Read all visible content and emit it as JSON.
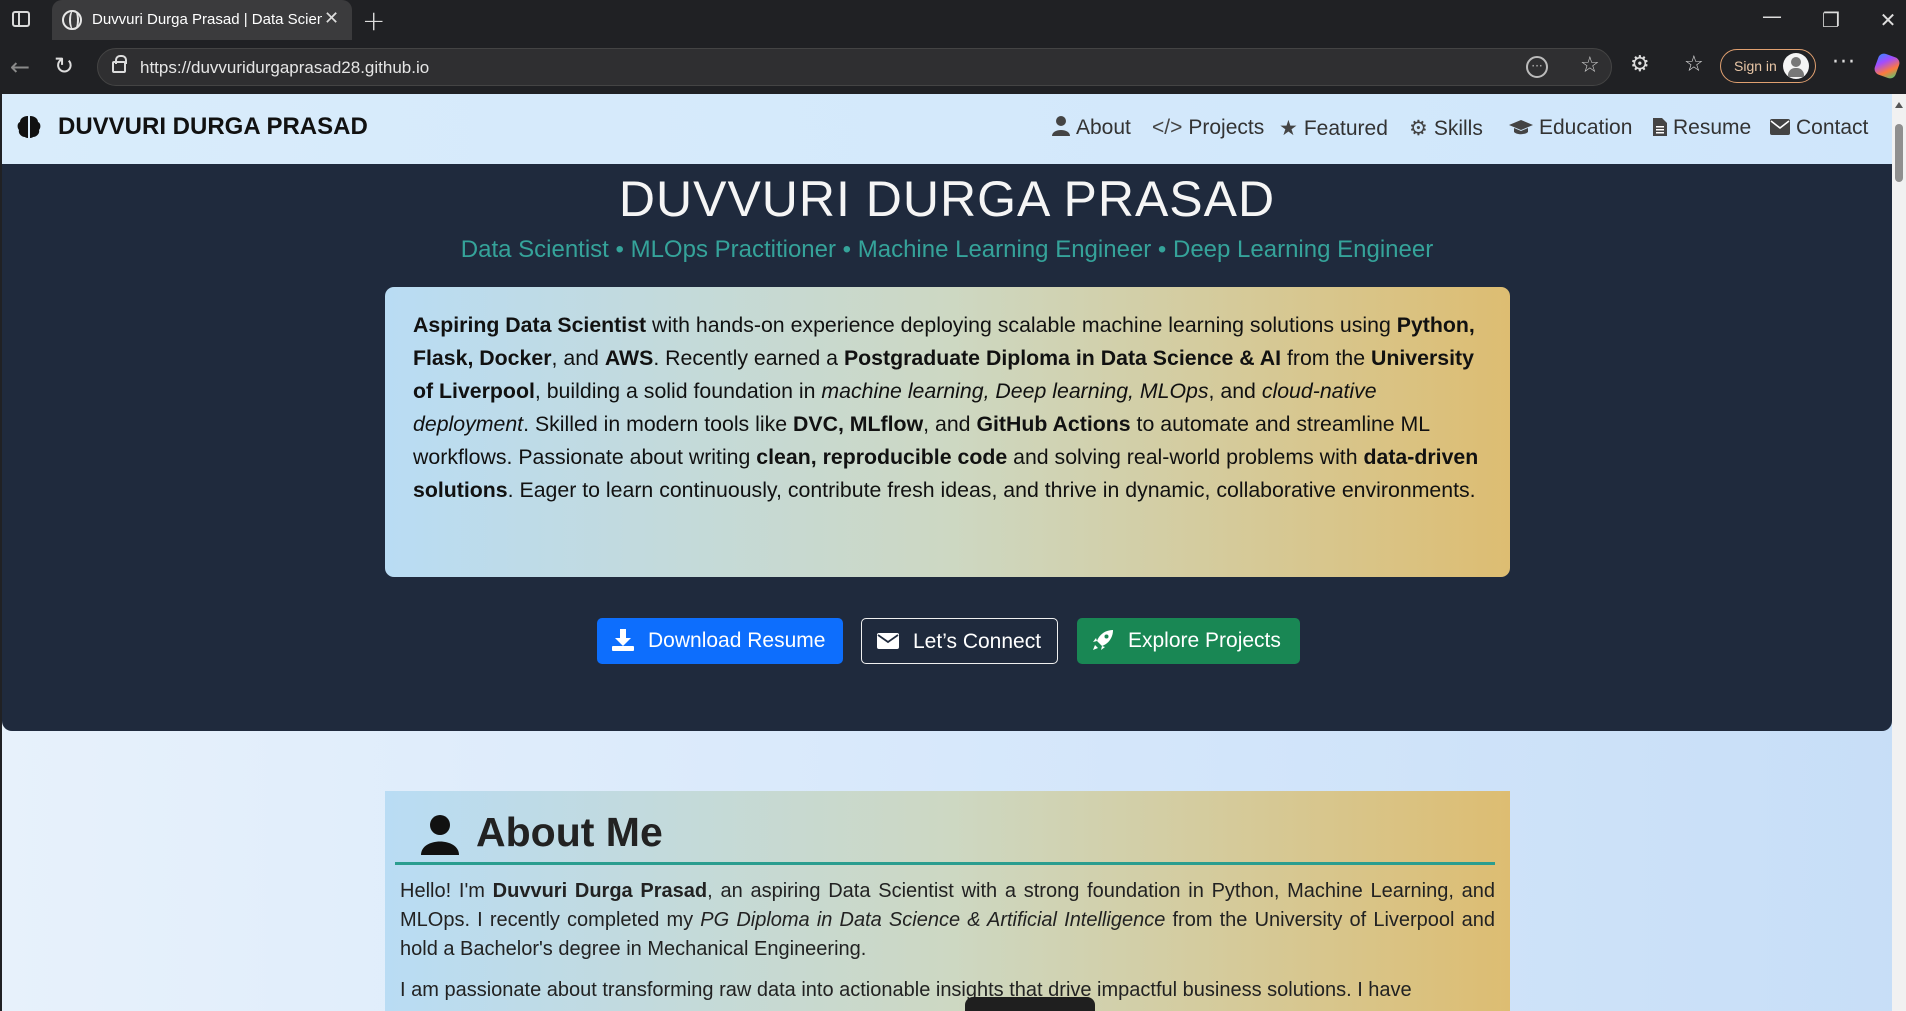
{
  "browser": {
    "tab_title": "Duvvuri Durga Prasad | Data Scientist",
    "url": "https://duvvuridurgaprasad28.github.io",
    "signin_label": "Sign in"
  },
  "navbar": {
    "brand": "DUVVURI DURGA PRASAD",
    "items": [
      {
        "label": "About",
        "icon": "user-icon"
      },
      {
        "label": "Projects",
        "icon": "code-icon"
      },
      {
        "label": "Featured",
        "icon": "star-icon"
      },
      {
        "label": "Skills",
        "icon": "gears-icon"
      },
      {
        "label": "Education",
        "icon": "graduation-cap-icon"
      },
      {
        "label": "Resume",
        "icon": "file-icon"
      },
      {
        "label": "Contact",
        "icon": "envelope-icon"
      }
    ]
  },
  "hero": {
    "name": "DUVVURI DURGA PRASAD",
    "subtitle": "Data Scientist • MLOps Practitioner • Machine Learning Engineer • Deep Learning Engineer",
    "summary": {
      "s1": "Aspiring Data Scientist",
      "s2": " with hands-on experience deploying scalable machine learning solutions using ",
      "s3": "Python, Flask, Docker",
      "s4": ", and ",
      "s5": "AWS",
      "s6": ". Recently earned a ",
      "s7": "Postgraduate Diploma in Data Science & AI",
      "s8": " from the ",
      "s9": "University of Liverpool",
      "s10": ", building a solid foundation in ",
      "s11": "machine learning, Deep learning, MLOps",
      "s12": ", and ",
      "s13": "cloud-native deployment",
      "s14": ". Skilled in modern tools like ",
      "s15": "DVC, MLflow",
      "s16": ", and ",
      "s17": "GitHub Actions",
      "s18": " to automate and streamline ML workflows. Passionate about writing ",
      "s19": "clean, reproducible code",
      "s20": " and solving real-world problems with ",
      "s21": "data-driven solutions",
      "s22": ". Eager to learn continuously, contribute fresh ideas, and thrive in dynamic, collaborative environments."
    },
    "buttons": {
      "download": "Download Resume",
      "connect": "Let’s Connect",
      "explore": "Explore Projects"
    }
  },
  "about": {
    "title": "About Me",
    "p1": {
      "a": "Hello! I'm ",
      "b": "Duvvuri Durga Prasad",
      "c": ", an aspiring Data Scientist with a strong foundation in Python, Machine Learning, and MLOps. I recently completed my ",
      "d": "PG Diploma in Data Science & Artificial Intelligence",
      "e": " from the University of Liverpool and hold a Bachelor's degree in Mechanical Engineering."
    },
    "p2": "I am passionate about transforming raw data into actionable insights that drive impactful business solutions. I have"
  },
  "colors": {
    "hero_bg": "#1f2a3d",
    "accent_teal": "#35a39a",
    "primary": "#0d6efd",
    "success": "#198754"
  }
}
